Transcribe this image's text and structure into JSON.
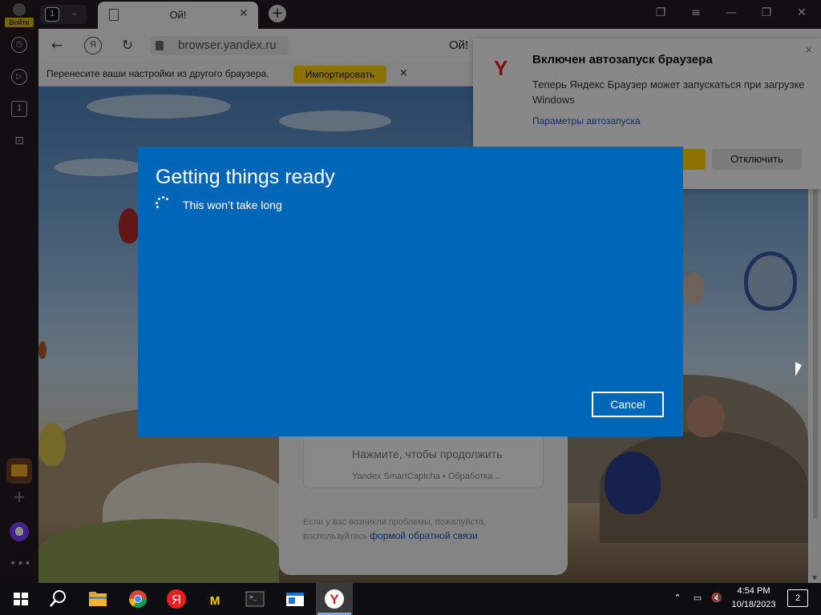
{
  "sidebar": {
    "login_label": "Войти",
    "counter": "1"
  },
  "tabs": {
    "count": "1",
    "active_title": "Ой!"
  },
  "address_bar": {
    "url": "browser.yandex.ru",
    "ya_label": "Я",
    "page_title": "Ой!"
  },
  "import_bar": {
    "message": "Перенесите ваши настройки из другого браузера.",
    "button": "Импортировать",
    "close": "×"
  },
  "captcha_card": {
    "prompt": "Нажмите, чтобы продолжить",
    "service": "Yandex SmartCaptcha • Обработка...",
    "help_text": "Если у вас возникли проблемы, пожалуйста, воспользуйтесь",
    "help_link": "формой обратной связи"
  },
  "notification": {
    "title": "Включен автозапуск браузера",
    "body": "Теперь Яндекс Браузер может запускаться при загрузке Windows",
    "link": "Параметры автозапуска",
    "disable_button": "Отключить"
  },
  "dialog": {
    "title": "Getting things ready",
    "subtitle": "This won’t take long",
    "cancel": "Cancel"
  },
  "taskbar": {
    "time": "4:54 PM",
    "date": "10/18/2023",
    "notifications_count": "2"
  },
  "colors": {
    "dialog_bg": "#0067b8",
    "yandex_yellow": "#ffd000",
    "yandex_red": "#e62020"
  }
}
